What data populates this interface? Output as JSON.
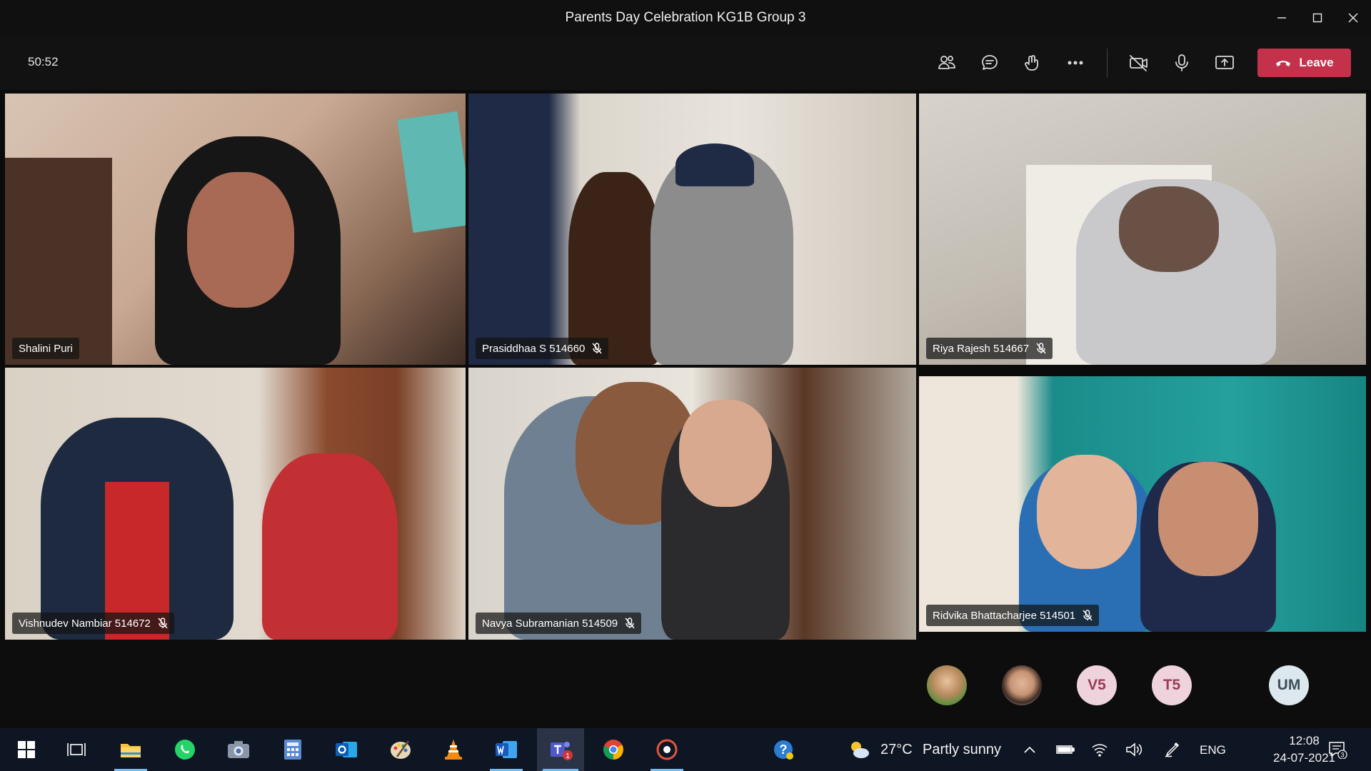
{
  "window": {
    "title": "Parents Day Celebration KG1B Group 3"
  },
  "toolbar": {
    "timer": "50:52",
    "leave_label": "Leave",
    "icons": [
      "participants-icon",
      "chat-icon",
      "reactions-icon",
      "more-options-icon",
      "camera-off-icon",
      "microphone-icon",
      "share-screen-icon"
    ]
  },
  "participants": [
    {
      "name": "Shalini Puri",
      "muted": false
    },
    {
      "name": "Prasiddhaa S 514660",
      "muted": true
    },
    {
      "name": "Riya Rajesh 514667",
      "muted": true
    },
    {
      "name": "Vishnudev Nambiar 514672",
      "muted": true
    },
    {
      "name": "Navya Subramanian 514509",
      "muted": true
    },
    {
      "name": "Ridvika Bhattacharjee 514501",
      "muted": true
    }
  ],
  "overflow": {
    "avatars": [
      {
        "type": "photo",
        "name": "photo-avatar-1"
      },
      {
        "type": "photo",
        "name": "photo-avatar-2"
      },
      {
        "type": "initials",
        "text": "V5"
      },
      {
        "type": "initials",
        "text": "T5"
      },
      {
        "type": "initials",
        "text": "UM"
      }
    ]
  },
  "taskbar": {
    "weather": "27°C",
    "weather_desc": "Partly sunny",
    "language": "ENG",
    "time": "12:08",
    "date": "24-07-2021",
    "teams_badge": "1",
    "notification_count": "3"
  },
  "colors": {
    "leave": "#c4314b",
    "titlebar": "#101010",
    "taskbar": "#0f1623"
  }
}
